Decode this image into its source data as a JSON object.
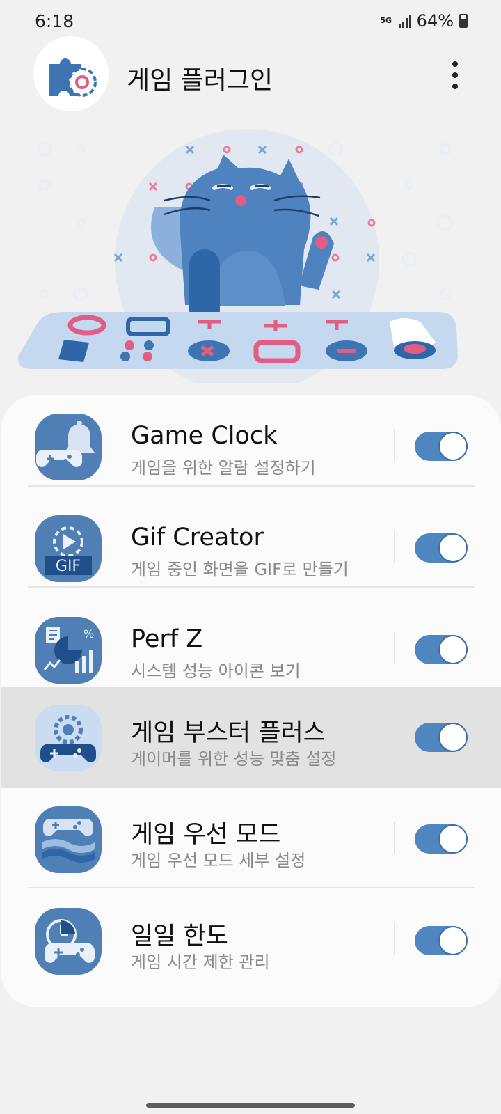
{
  "status_bar": {
    "time": "6:18",
    "network": "5G",
    "battery": "64%"
  },
  "header": {
    "title": "게임 플러그인",
    "more_icon": "more-vert-icon"
  },
  "colors": {
    "accent": "#4f86c0",
    "icon_bg": "#4f7fb5",
    "card_bg": "#fbfbfb",
    "page_bg": "#f1f1f1",
    "highlight_bg": "#e2e2e2"
  },
  "plugins": [
    {
      "name": "Game Clock",
      "description": "게임을 위한 알람 설정하기",
      "icon": "game-clock-icon",
      "enabled": true,
      "highlighted": false
    },
    {
      "name": "Gif Creator",
      "description": "게임 중인 화면을 GIF로 만들기",
      "icon": "gif-creator-icon",
      "icon_text": "GIF",
      "enabled": true,
      "highlighted": false
    },
    {
      "name": "Perf Z",
      "description": "시스템 성능 아이콘 보기",
      "icon": "perf-z-icon",
      "icon_text": "%",
      "enabled": true,
      "highlighted": false
    },
    {
      "name": "게임 부스터 플러스",
      "description": "게이머를 위한 성능 맞춤 설정",
      "icon": "game-booster-plus-icon",
      "enabled": true,
      "highlighted": true
    },
    {
      "name": "게임 우선 모드",
      "description": "게임 우선 모드 세부 설정",
      "icon": "game-priority-mode-icon",
      "enabled": true,
      "highlighted": false
    },
    {
      "name": "일일 한도",
      "description": "게임 시간 제한 관리",
      "icon": "daily-limit-icon",
      "enabled": true,
      "highlighted": false
    }
  ]
}
